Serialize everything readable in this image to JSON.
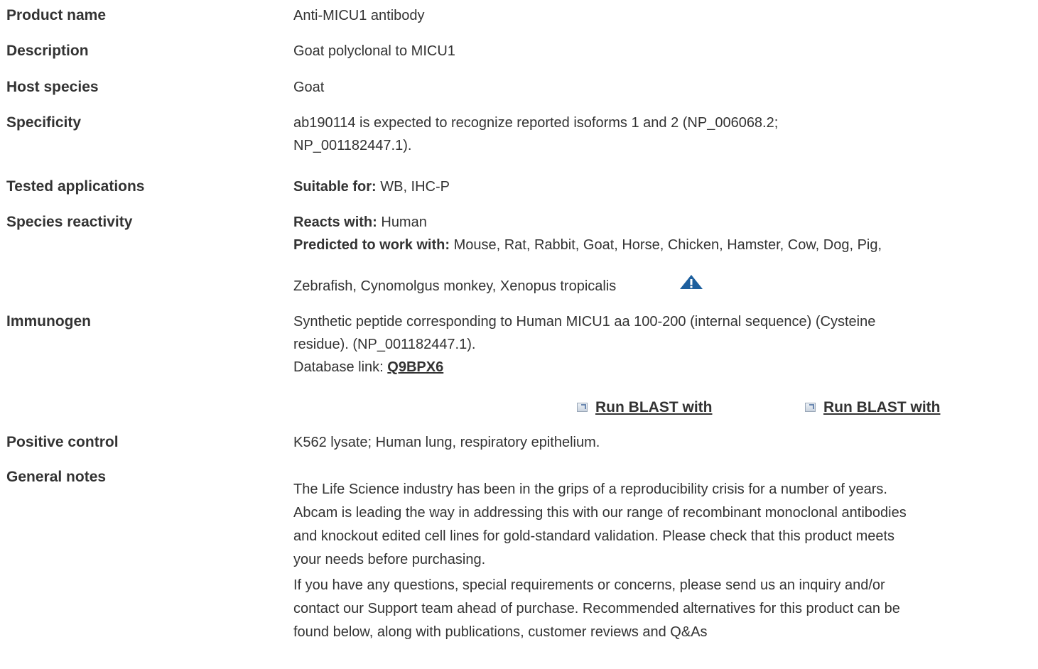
{
  "rows": {
    "product_name": {
      "label": "Product name",
      "value": "Anti-MICU1 antibody"
    },
    "description": {
      "label": "Description",
      "value": "Goat polyclonal to MICU1"
    },
    "host_species": {
      "label": "Host species",
      "value": "Goat"
    },
    "specificity": {
      "label": "Specificity",
      "line1": "ab190114 is expected to recognize reported isoforms 1 and 2 (NP_006068.2;",
      "line2": "NP_001182447.1)."
    },
    "tested_applications": {
      "label": "Tested applications",
      "key": "Suitable for:",
      "value": " WB, IHC-P"
    },
    "species_reactivity": {
      "label": "Species reactivity",
      "reacts_key": "Reacts with:",
      "reacts_value": " Human",
      "predicted_key": "Predicted to work with:",
      "predicted_line1": " Mouse, Rat, Rabbit, Goat, Horse, Chicken, Hamster, Cow, Dog, Pig,",
      "predicted_line2": "Zebrafish, Cynomolgus monkey, Xenopus tropicalis",
      "warning_icon": "warning-triangle-icon"
    },
    "immunogen": {
      "label": "Immunogen",
      "line1": "Synthetic peptide corresponding to Human MICU1 aa 100-200 (internal sequence) (Cysteine",
      "line2": "residue). (NP_001182447.1).",
      "db_prefix": "Database link: ",
      "db_link": "Q9BPX6",
      "blast_1": "Run BLAST with",
      "blast_2": "Run BLAST with"
    },
    "positive_control": {
      "label": "Positive control",
      "value": "K562 lysate; Human lung, respiratory epithelium."
    },
    "general_notes": {
      "label": "General notes",
      "para1_line1": "The Life Science industry has been in the grips of a reproducibility crisis for a number of years.",
      "para1_line2": "Abcam is leading the way in addressing this with our range of recombinant monoclonal antibodies",
      "para1_line3": "and knockout edited cell lines for gold-standard validation. Please check that this product meets",
      "para1_line4": "your needs before purchasing.",
      "para2_line1": "If you have any questions, special requirements or concerns, please send us an inquiry and/or",
      "para2_line2": "contact our Support team ahead of purchase. Recommended alternatives for this product can be",
      "para2_line3": "found below, along with publications, customer reviews and Q&As"
    }
  },
  "colors": {
    "text": "#333333",
    "warning_icon": "#1d5f9e"
  }
}
